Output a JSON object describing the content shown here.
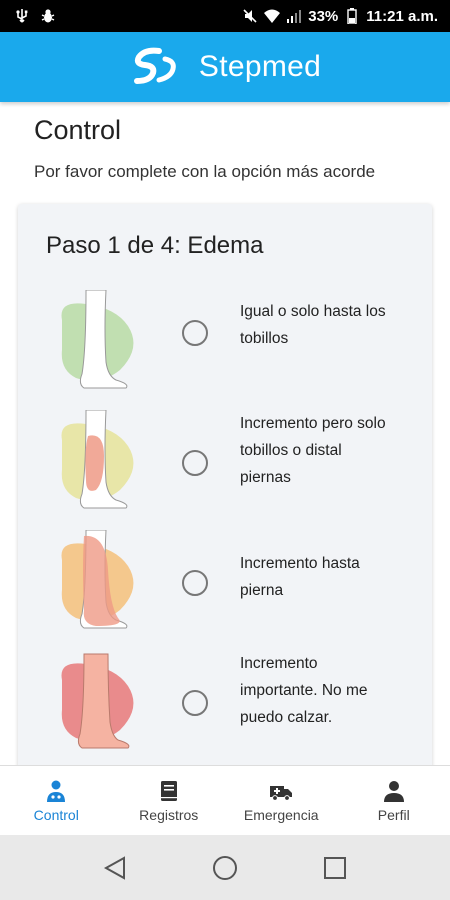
{
  "status_bar": {
    "battery": "33%",
    "time": "11:21 a.m.",
    "icons": [
      "usb-icon",
      "debug-icon",
      "mute-icon",
      "wifi-icon",
      "signal-icon",
      "battery-icon"
    ]
  },
  "header": {
    "app_name": "Stepmed",
    "logo_icon": "stepmed-logo-icon",
    "color": "#1aa9ec"
  },
  "page": {
    "title": "Control",
    "subtitle": "Por favor complete con la opción más acorde"
  },
  "card": {
    "title": "Paso 1 de 4: Edema",
    "options": [
      {
        "label_lines": [
          "Igual o solo hasta los",
          "tobillos"
        ],
        "color": "#b9dba5",
        "selected": false
      },
      {
        "label_lines": [
          "Incremento pero solo",
          "tobillos o distal",
          "piernas"
        ],
        "color": "#e6e39a",
        "selected": false
      },
      {
        "label_lines": [
          "Incremento hasta",
          "pierna"
        ],
        "color": "#f4c07a",
        "selected": false
      },
      {
        "label_lines": [
          "Incremento",
          "importante. No me",
          "puedo calzar."
        ],
        "color": "#e88080",
        "selected": false
      }
    ]
  },
  "bottom_nav": {
    "active_color": "#1a84d6",
    "items": [
      {
        "label": "Control",
        "icon": "doctor-icon",
        "active": true
      },
      {
        "label": "Registros",
        "icon": "book-icon",
        "active": false
      },
      {
        "label": "Emergencia",
        "icon": "ambulance-icon",
        "active": false
      },
      {
        "label": "Perfil",
        "icon": "person-icon",
        "active": false
      }
    ]
  },
  "system_nav": {
    "icons": [
      "back-icon",
      "home-icon",
      "recents-icon"
    ]
  }
}
